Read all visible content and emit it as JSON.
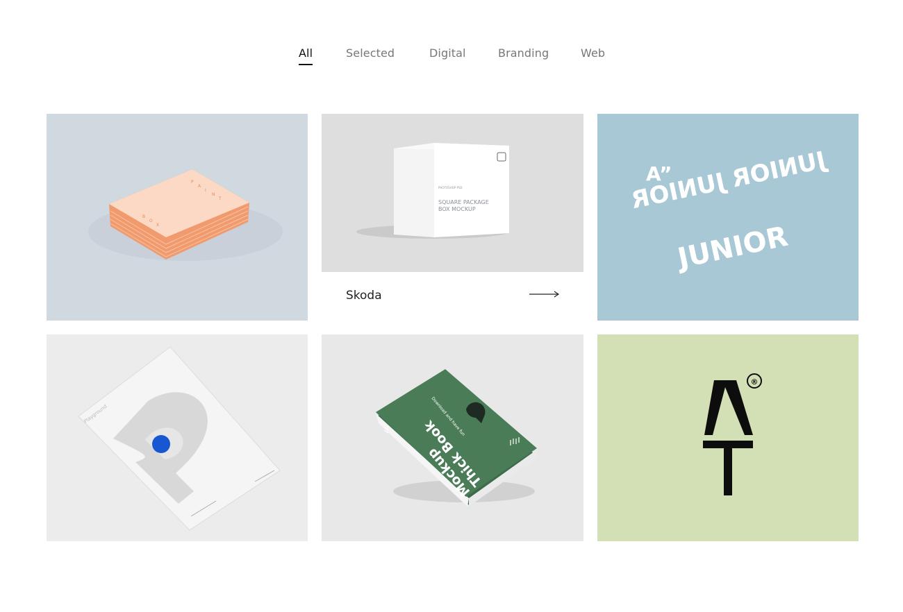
{
  "filters": {
    "items": [
      {
        "label": "All",
        "active": true
      },
      {
        "label": "Selected",
        "active": false
      },
      {
        "label": "Digital",
        "active": false
      },
      {
        "label": "Branding",
        "active": false
      },
      {
        "label": "Web",
        "active": false
      }
    ]
  },
  "portfolio": {
    "items": [
      {
        "image": "stacked-business-cards-mockup",
        "background": "#d0d8e0",
        "art_text": [
          "B",
          "O",
          "X",
          "P",
          "A",
          "I",
          "N",
          "T"
        ]
      },
      {
        "image": "square-package-box-mockup",
        "background": "#dedede",
        "art_text": [
          "PHOTOSHOP PSD",
          "SQUARE PACKAGE",
          "BOX MOCKUP"
        ],
        "caption": "Skoda",
        "arrow_icon": "long-arrow-right-icon"
      },
      {
        "image": "junior-typography-ring",
        "background": "#a9c8d6",
        "art_text": [
          "A”",
          "JUNIOR",
          "JUNIOR JUNIOR"
        ]
      },
      {
        "image": "playground-p-poster-mockup",
        "background": "#ececec",
        "art_text": [
          "Playground"
        ]
      },
      {
        "image": "green-thick-book-mockup",
        "background": "#e8e8e8",
        "art_text": [
          "Thick Book",
          "Mockup",
          "Download and have fun"
        ]
      },
      {
        "image": "at-monogram-logo",
        "background": "#d3e0b6",
        "art_text": [
          "®"
        ]
      }
    ]
  }
}
